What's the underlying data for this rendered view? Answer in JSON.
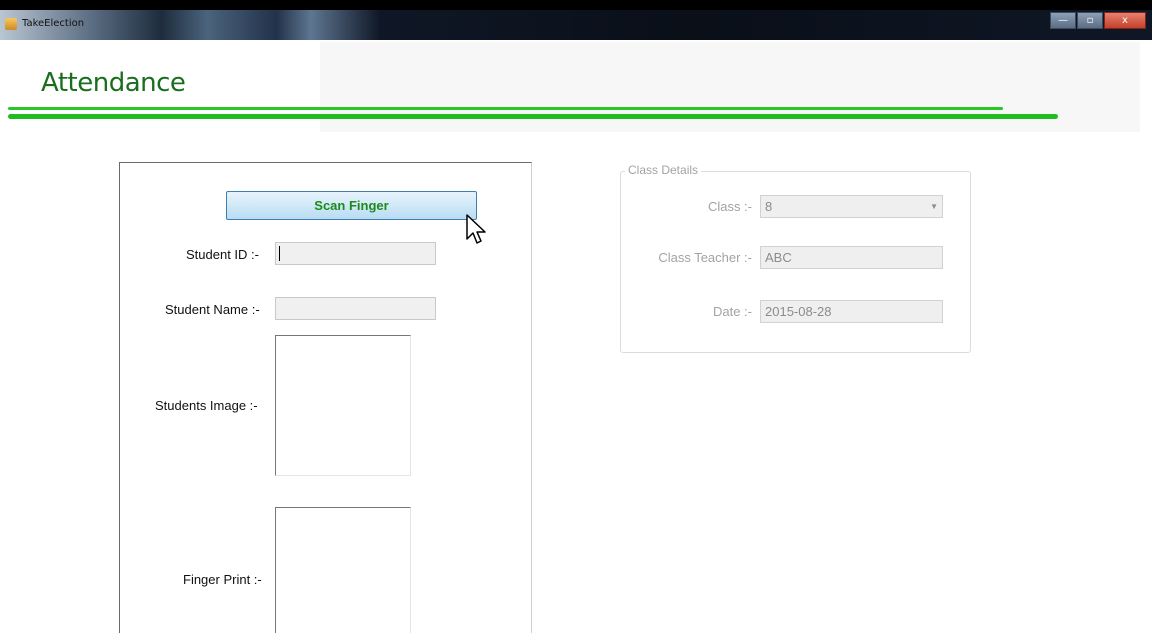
{
  "window": {
    "title": "TakeElection"
  },
  "window_controls": {
    "minimize": "—",
    "maximize": "▫",
    "close": "x"
  },
  "page": {
    "heading": "Attendance"
  },
  "student": {
    "scan_button": "Scan Finger",
    "id_label": "Student ID :-",
    "id_value": "",
    "name_label": "Student Name :-",
    "name_value": "",
    "image_label": "Students Image :-",
    "fingerprint_label": "Finger Print :-"
  },
  "class_details": {
    "legend": "Class Details",
    "class_label": "Class :-",
    "class_value": "8",
    "teacher_label": "Class Teacher :-",
    "teacher_value": "ABC",
    "date_label": "Date :-",
    "date_value": "2015-08-28"
  },
  "colors": {
    "accent_green": "#1fbd1f",
    "heading_green": "#1a6f1f",
    "button_text": "#1b8b1b"
  }
}
